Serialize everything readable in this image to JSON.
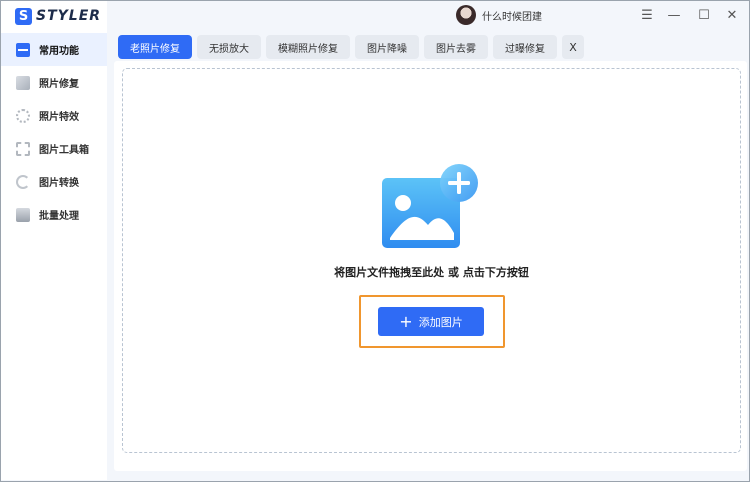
{
  "app": {
    "logo_letter": "S",
    "name": "STYLER"
  },
  "user": {
    "name": "什么时候团建"
  },
  "window_controls": {
    "menu": "☰",
    "minimize": "—",
    "maximize": "☐",
    "close": "✕"
  },
  "sidebar": {
    "items": [
      {
        "label": "常用功能",
        "icon": "home-icon",
        "active": true
      },
      {
        "label": "照片修复",
        "icon": "photo-icon"
      },
      {
        "label": "照片特效",
        "icon": "effect-icon"
      },
      {
        "label": "图片工具箱",
        "icon": "toolbox-icon"
      },
      {
        "label": "图片转换",
        "icon": "convert-icon"
      },
      {
        "label": "批量处理",
        "icon": "batch-icon"
      }
    ]
  },
  "tabs": [
    {
      "label": "老照片修复",
      "active": true
    },
    {
      "label": "无损放大"
    },
    {
      "label": "模糊照片修复"
    },
    {
      "label": "图片降噪"
    },
    {
      "label": "图片去雾"
    },
    {
      "label": "过曝修复"
    }
  ],
  "tab_close": "X",
  "dropzone": {
    "hint": "将图片文件拖拽至此处 或 点击下方按钮",
    "button_plus": "+",
    "button_label": "添加图片"
  },
  "colors": {
    "accent": "#2f6bf5",
    "highlight": "#f0962e"
  }
}
